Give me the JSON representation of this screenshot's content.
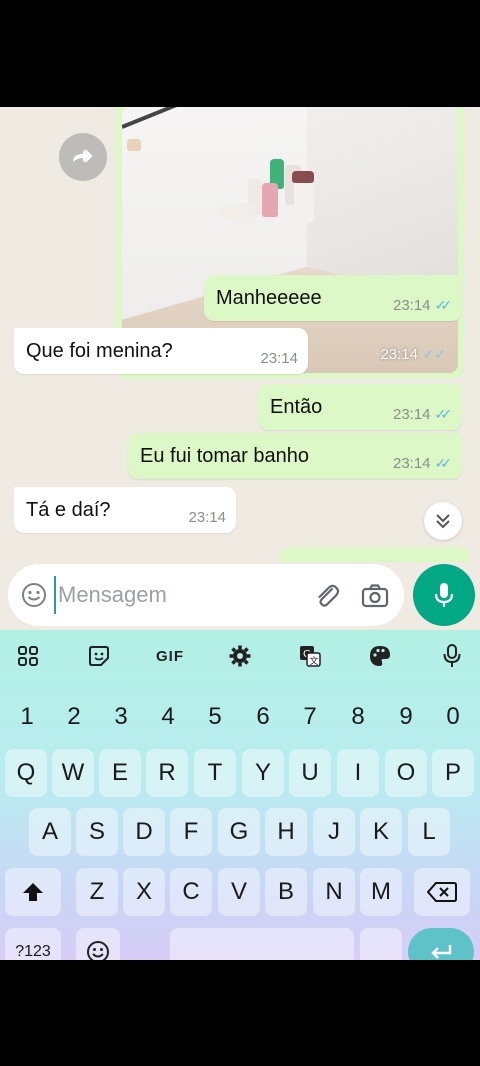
{
  "messages": [
    {
      "type": "image",
      "direction": "out",
      "time": "23:14",
      "status": "read"
    },
    {
      "type": "text",
      "direction": "out",
      "text": "Manheeeee",
      "time": "23:14",
      "status": "read"
    },
    {
      "type": "text",
      "direction": "in",
      "text": "Que foi menina?",
      "time": "23:14"
    },
    {
      "type": "text",
      "direction": "out",
      "text": "Então",
      "time": "23:14",
      "status": "read"
    },
    {
      "type": "text",
      "direction": "out",
      "text": "Eu fui tomar banho",
      "time": "23:14",
      "status": "read"
    },
    {
      "type": "text",
      "direction": "in",
      "text": "Tá e daí?",
      "time": "23:14"
    }
  ],
  "input": {
    "placeholder": "Mensagem",
    "value": ""
  },
  "keyboard": {
    "toolbar": [
      "apps-icon",
      "sticker-icon",
      "GIF",
      "settings-icon",
      "translate-icon",
      "palette-icon",
      "mic-icon"
    ],
    "gif_label": "GIF",
    "row_numbers": [
      "1",
      "2",
      "3",
      "4",
      "5",
      "6",
      "7",
      "8",
      "9",
      "0"
    ],
    "row1": [
      "Q",
      "W",
      "E",
      "R",
      "T",
      "Y",
      "U",
      "I",
      "O",
      "P"
    ],
    "row2": [
      "A",
      "S",
      "D",
      "F",
      "G",
      "H",
      "J",
      "K",
      "L"
    ],
    "row3": [
      "Z",
      "X",
      "C",
      "V",
      "B",
      "N",
      "M"
    ],
    "symbols_key": "?123"
  },
  "colors": {
    "outgoing_bubble": "#dcf8c6",
    "incoming_bubble": "#ffffff",
    "chat_background": "#efeae2",
    "accent": "#00a884",
    "read_ticks": "#53bdeb"
  }
}
